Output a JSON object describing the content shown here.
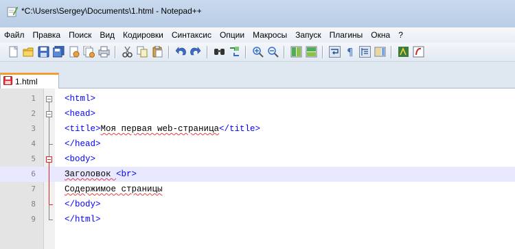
{
  "window": {
    "title": "*C:\\Users\\Sergey\\Documents\\1.html - Notepad++"
  },
  "menu": [
    "Файл",
    "Правка",
    "Поиск",
    "Вид",
    "Кодировки",
    "Синтаксис",
    "Опции",
    "Макросы",
    "Запуск",
    "Плагины",
    "Окна",
    "?"
  ],
  "toolbar": {
    "buttons": [
      "new-file-icon",
      "open-file-icon",
      "save-icon",
      "save-all-icon",
      "close-icon",
      "close-all-icon",
      "print-icon",
      "cut-icon",
      "copy-icon",
      "paste-icon",
      "undo-icon",
      "redo-icon",
      "find-icon",
      "replace-icon",
      "zoom-in-icon",
      "zoom-out-icon",
      "sync-v-icon",
      "sync-h-icon",
      "wrap-icon",
      "all-chars-icon",
      "indent-guide-icon",
      "doc-map-icon",
      "function-list-icon",
      "record-macro-icon"
    ]
  },
  "tab": {
    "label": "1.html",
    "modified": true
  },
  "editor": {
    "current_line": 6,
    "lines": [
      {
        "num": "1",
        "segments": [
          {
            "t": "<html>",
            "c": "tag"
          }
        ]
      },
      {
        "num": "2",
        "segments": [
          {
            "t": "<head>",
            "c": "tag"
          }
        ]
      },
      {
        "num": "3",
        "segments": [
          {
            "t": "<title>",
            "c": "tag"
          },
          {
            "t": "Моя первая web-страница",
            "c": "txt"
          },
          {
            "t": "</title>",
            "c": "tag"
          }
        ]
      },
      {
        "num": "4",
        "segments": [
          {
            "t": "</head>",
            "c": "tag"
          }
        ]
      },
      {
        "num": "5",
        "segments": [
          {
            "t": "<body>",
            "c": "tag"
          }
        ]
      },
      {
        "num": "6",
        "segments": [
          {
            "t": "Заголовок ",
            "c": "txt"
          },
          {
            "t": "<br>",
            "c": "tag"
          }
        ]
      },
      {
        "num": "7",
        "segments": [
          {
            "t": "Содержимое страницы",
            "c": "txt"
          }
        ]
      },
      {
        "num": "8",
        "segments": [
          {
            "t": "</body>",
            "c": "tag"
          }
        ]
      },
      {
        "num": "9",
        "segments": [
          {
            "t": "</html>",
            "c": "tag"
          }
        ]
      }
    ]
  },
  "colors": {
    "tag": "#0000ff",
    "text": "#000000",
    "current_line": "#e8e8ff",
    "fold_active": "#e02020",
    "tab_accent": "#f39c32"
  }
}
